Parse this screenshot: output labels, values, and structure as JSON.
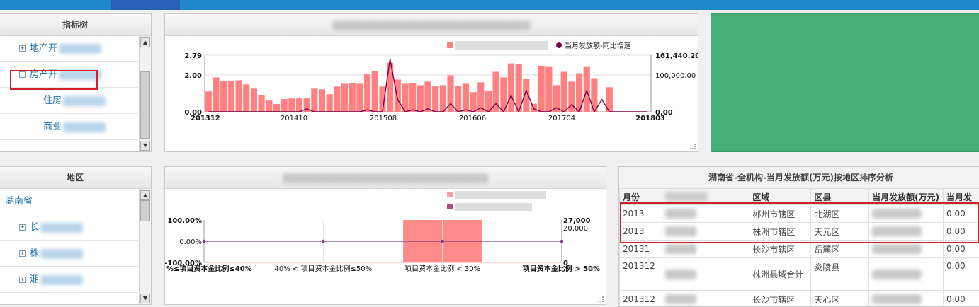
{
  "topbar": {
    "tabs": [
      "",
      "",
      "",
      "",
      ""
    ],
    "active_index": 2
  },
  "index_tree": {
    "title": "指标树",
    "items": [
      {
        "label": "地产开",
        "indent": 1,
        "expander": "+"
      },
      {
        "label": "房产开",
        "indent": 1,
        "expander": "-",
        "selected": true
      },
      {
        "label": "住房",
        "indent": 2,
        "expander": ""
      },
      {
        "label": "商业",
        "indent": 2,
        "expander": ""
      }
    ]
  },
  "region_tree": {
    "title": "地区",
    "items": [
      {
        "label": "湖南省",
        "indent": 0,
        "expander": ""
      },
      {
        "label": "长",
        "indent": 1,
        "expander": "+"
      },
      {
        "label": "株",
        "indent": 1,
        "expander": "+"
      },
      {
        "label": "湘",
        "indent": 1,
        "expander": "+"
      }
    ]
  },
  "chart_data": [
    {
      "type": "bar",
      "title": "",
      "legend": [
        {
          "name": "",
          "color": "#ff8080",
          "kind": "bar"
        },
        {
          "name": "当月发放额-同比增速",
          "color": "#800050",
          "kind": "line"
        }
      ],
      "x_labels": [
        "201312",
        "201410",
        "201508",
        "201606",
        "201704",
        "201803"
      ],
      "y_left_ticks": [
        "0.00",
        "2.00",
        "2.79"
      ],
      "y_right_ticks": [
        "0.00",
        "100,000.00",
        "161,440.20"
      ],
      "ylim_left": [
        0,
        2.79
      ],
      "ylim_right": [
        0,
        161440.2
      ],
      "bar_color": "#ff8080",
      "line_color": "#800050",
      "bars": [
        58000,
        98000,
        88000,
        88000,
        90000,
        78000,
        66000,
        48000,
        32000,
        22000,
        36000,
        38000,
        38000,
        38000,
        66000,
        64000,
        50000,
        72000,
        80000,
        82000,
        80000,
        108000,
        115000,
        72000,
        140000,
        92000,
        80000,
        82000,
        76000,
        86000,
        74000,
        76000,
        104000,
        74000,
        80000,
        56000,
        84000,
        60000,
        114000,
        98000,
        138000,
        136000,
        94000,
        23000,
        130000,
        128000,
        76000,
        114000,
        86000,
        110000,
        128000,
        96000,
        0,
        70000,
        0,
        0,
        0,
        0,
        0
      ],
      "line": [
        0,
        0,
        0,
        0,
        0,
        0,
        0,
        0,
        0,
        0,
        0,
        0,
        0,
        0.15,
        0,
        0,
        0,
        0,
        0,
        0,
        0,
        0.1,
        0,
        0,
        2.6,
        0.6,
        0,
        0.1,
        0,
        0.15,
        0,
        0,
        0.4,
        0,
        0.1,
        0,
        0.2,
        0,
        0.4,
        0,
        0.8,
        0,
        1.05,
        0.15,
        0,
        0,
        0.2,
        0,
        0.35,
        0,
        1.05,
        0,
        0.6,
        0,
        0,
        0,
        0,
        0,
        0
      ],
      "line_hi": {
        "i24": 2.6
      }
    },
    {
      "type": "bar",
      "title": "",
      "legend": [
        {
          "name": "",
          "color": "#ff9aa8"
        },
        {
          "name": "",
          "color": "#b05080"
        }
      ],
      "categories": [
        "%≤项目资本金比例≤40%",
        "40% < 项目资本金比例≤50%",
        "项目资本金比例 < 30%",
        "项目资本金比例 > 50%"
      ],
      "y_left_ticks": [
        "-100.00%",
        "0.00%",
        "100.00%"
      ],
      "y_right_ticks": [
        "0",
        "20,000",
        "27,000"
      ],
      "values": [
        0,
        0,
        27000,
        0
      ],
      "line": [
        0,
        0,
        0,
        0
      ],
      "ylim_left": [
        -100,
        100
      ],
      "ylim_right": [
        0,
        27000
      ],
      "bar_color": "#ff8a8a",
      "line_color": "#7a3a7a"
    }
  ],
  "ranking_table": {
    "title": "湖南省-全机构-当月发放额(万元)按地区排序分析",
    "columns": [
      "月份",
      "",
      "区域",
      "区县",
      "当月发放额(万元)",
      "当月发"
    ],
    "rows": [
      {
        "month": "2013",
        "org": "",
        "area": "郴州市辖区",
        "county": "北湖区",
        "amount": "",
        "rate": "0.00"
      },
      {
        "month": "2013",
        "org": "",
        "area": "株洲市辖区",
        "county": "天元区",
        "amount": "",
        "rate": "0.00"
      },
      {
        "month": "20131",
        "org": "",
        "area": "长沙市辖区",
        "county": "岳麓区",
        "amount": "",
        "rate": "0.00"
      },
      {
        "month": "201312",
        "org": "",
        "area": "株洲县域合计",
        "county": "炎陵县",
        "amount": "",
        "rate": "0.00"
      },
      {
        "month": "201312",
        "org": "",
        "area": "长沙市辖区",
        "county": "天心区",
        "amount": "",
        "rate": "0.00"
      }
    ]
  },
  "colors": {
    "accent": "#1f88c9",
    "green_panel": "#47ae7a",
    "highlight": "#d0202a"
  }
}
